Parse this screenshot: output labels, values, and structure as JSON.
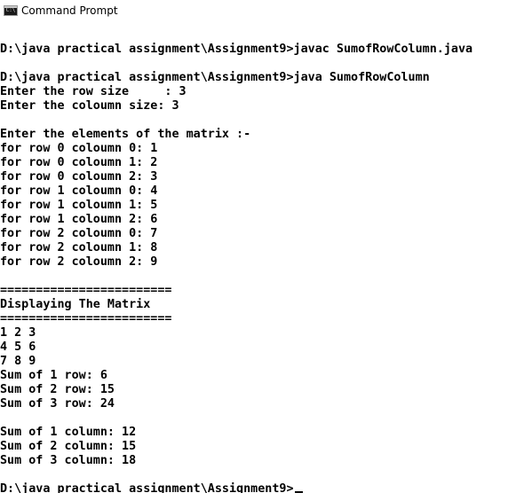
{
  "window": {
    "title": "Command Prompt",
    "icon": "cmd-icon",
    "icon_glyph": "C:\\"
  },
  "console": {
    "lines": [
      "",
      "D:\\java practical assignment\\Assignment9>javac SumofRowColumn.java",
      "",
      "D:\\java practical assignment\\Assignment9>java SumofRowColumn",
      "Enter the row size     : 3",
      "Enter the coloumn size: 3",
      "",
      "Enter the elements of the matrix :-",
      "for row 0 coloumn 0: 1",
      "for row 0 coloumn 1: 2",
      "for row 0 coloumn 2: 3",
      "for row 1 coloumn 0: 4",
      "for row 1 coloumn 1: 5",
      "for row 1 coloumn 2: 6",
      "for row 2 coloumn 0: 7",
      "for row 2 coloumn 1: 8",
      "for row 2 coloumn 2: 9",
      "",
      "========================",
      "Displaying The Matrix",
      "========================",
      "1 2 3",
      "4 5 6",
      "7 8 9",
      "Sum of 1 row: 6",
      "Sum of 2 row: 15",
      "Sum of 3 row: 24",
      "",
      "Sum of 1 column: 12",
      "Sum of 2 column: 15",
      "Sum of 3 column: 18",
      ""
    ],
    "prompt": "D:\\java practical assignment\\Assignment9>"
  },
  "colors": {
    "background": "#ffffff",
    "text": "#000000"
  }
}
